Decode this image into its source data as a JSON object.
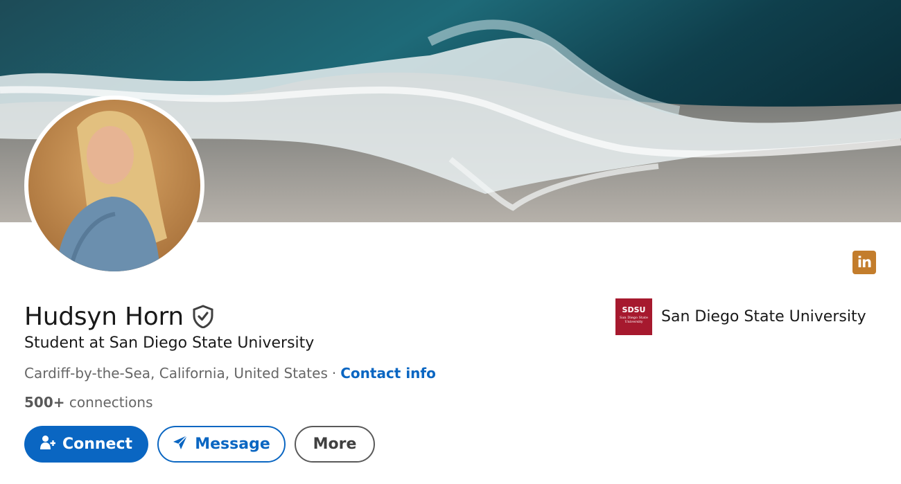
{
  "profile": {
    "name": "Hudsyn Horn",
    "headline": "Student at San Diego State University",
    "location": "Cardiff-by-the-Sea, California, United States",
    "separator": "·",
    "contact_info_label": "Contact info",
    "connections_count": "500+",
    "connections_label": "connections"
  },
  "actions": {
    "connect_label": "Connect",
    "message_label": "Message",
    "more_label": "More"
  },
  "education": {
    "school_name": "San Diego State University",
    "logo_abbr": "SDSU",
    "logo_subtitle": "San Diego State University"
  },
  "badge": {
    "label": "in"
  },
  "icons": {
    "verified": "shield-check-icon",
    "connect": "add-person-icon",
    "message": "paper-plane-icon",
    "brand": "linkedin-icon"
  },
  "colors": {
    "primary": "#0a66c2",
    "linkedin_badge": "#c37d2c",
    "school_logo": "#a6192e",
    "text_secondary": "#666666"
  }
}
